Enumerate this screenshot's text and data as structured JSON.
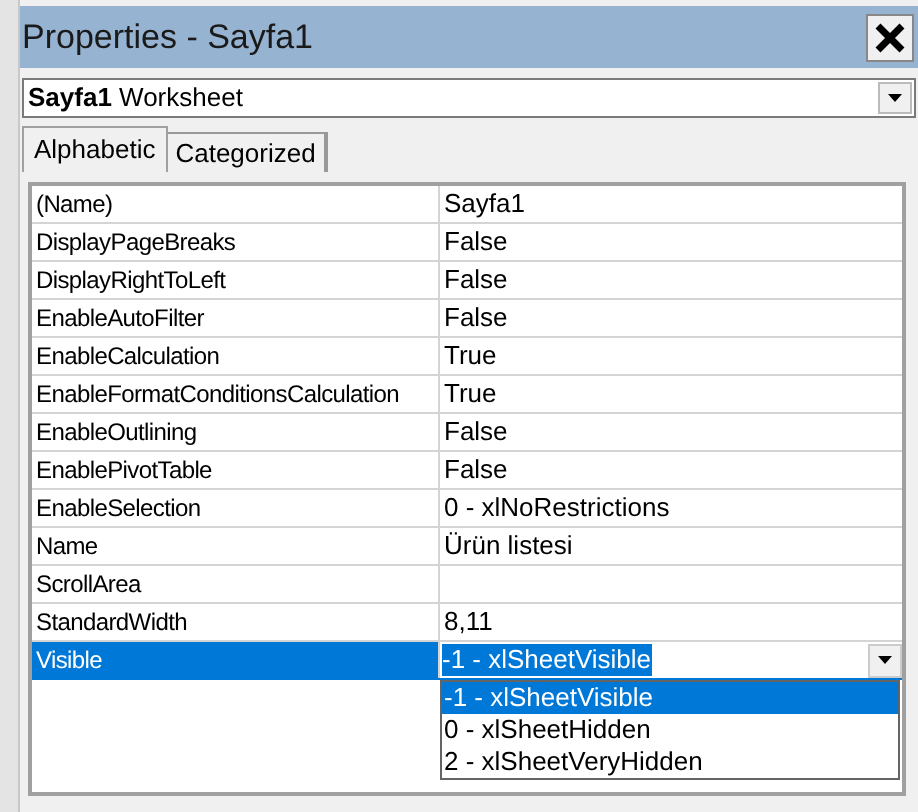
{
  "window": {
    "title": "Properties - Sayfa1"
  },
  "object_selector": {
    "name": "Sayfa1",
    "type": "Worksheet"
  },
  "tabs": [
    {
      "label": "Alphabetic",
      "selected": true
    },
    {
      "label": "Categorized",
      "selected": false
    }
  ],
  "properties": [
    {
      "name": "(Name)",
      "value": "Sayfa1",
      "kind": "text",
      "selected": false
    },
    {
      "name": "DisplayPageBreaks",
      "value": "False",
      "kind": "text",
      "selected": false
    },
    {
      "name": "DisplayRightToLeft",
      "value": "False",
      "kind": "text",
      "selected": false
    },
    {
      "name": "EnableAutoFilter",
      "value": "False",
      "kind": "text",
      "selected": false
    },
    {
      "name": "EnableCalculation",
      "value": "True",
      "kind": "text",
      "selected": false
    },
    {
      "name": "EnableFormatConditionsCalculation",
      "value": "True",
      "kind": "text",
      "selected": false
    },
    {
      "name": "EnableOutlining",
      "value": "False",
      "kind": "text",
      "selected": false
    },
    {
      "name": "EnablePivotTable",
      "value": "False",
      "kind": "text",
      "selected": false
    },
    {
      "name": "EnableSelection",
      "value": "0 - xlNoRestrictions",
      "kind": "text",
      "selected": false
    },
    {
      "name": "Name",
      "value": "Ürün listesi",
      "kind": "text",
      "selected": false
    },
    {
      "name": "ScrollArea",
      "kind": "text",
      "selected": false
    },
    {
      "name": "StandardWidth",
      "value": "8,11",
      "kind": "text",
      "selected": false
    },
    {
      "name": "Visible",
      "value": "-1 - xlSheetVisible",
      "kind": "dropdown",
      "selected": true
    }
  ],
  "dropdown_options": [
    {
      "label": "-1 - xlSheetVisible",
      "selected": true
    },
    {
      "label": "0 - xlSheetHidden",
      "selected": false
    },
    {
      "label": "2 - xlSheetVeryHidden",
      "selected": false
    }
  ]
}
